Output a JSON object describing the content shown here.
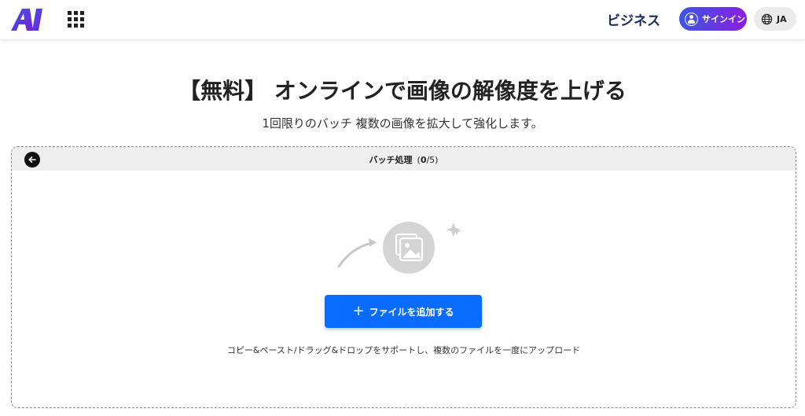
{
  "header": {
    "logo_text": "AI",
    "business_label": "ビジネス",
    "signin_label": "サインイン",
    "lang_label": "JA"
  },
  "hero": {
    "title": "【無料】 オンラインで画像の解像度を上げる",
    "subtitle": "1回限りのバッチ 複数の画像を拡大して強化します。"
  },
  "panel": {
    "bar_title": "バッチ処理",
    "count_open": "(",
    "count_current": "0",
    "count_total": "/5)",
    "add_button_label": "ファイルを追加する",
    "hint": "コピー&ペースト/ドラッグ&ドロップをサポートし、複数のファイルを一度にアップロード"
  },
  "colors": {
    "accent_blue": "#0a6cff",
    "signin_gradient_start": "#3b56e6",
    "signin_gradient_end": "#8a1ee0",
    "business_text": "#1a2b5e"
  },
  "icons": [
    "ai-logo-icon",
    "apps-grid-icon",
    "user-icon",
    "globe-icon",
    "arrow-left-icon",
    "images-icon",
    "sparkle-icon",
    "curved-arrow-icon",
    "plus-icon"
  ]
}
